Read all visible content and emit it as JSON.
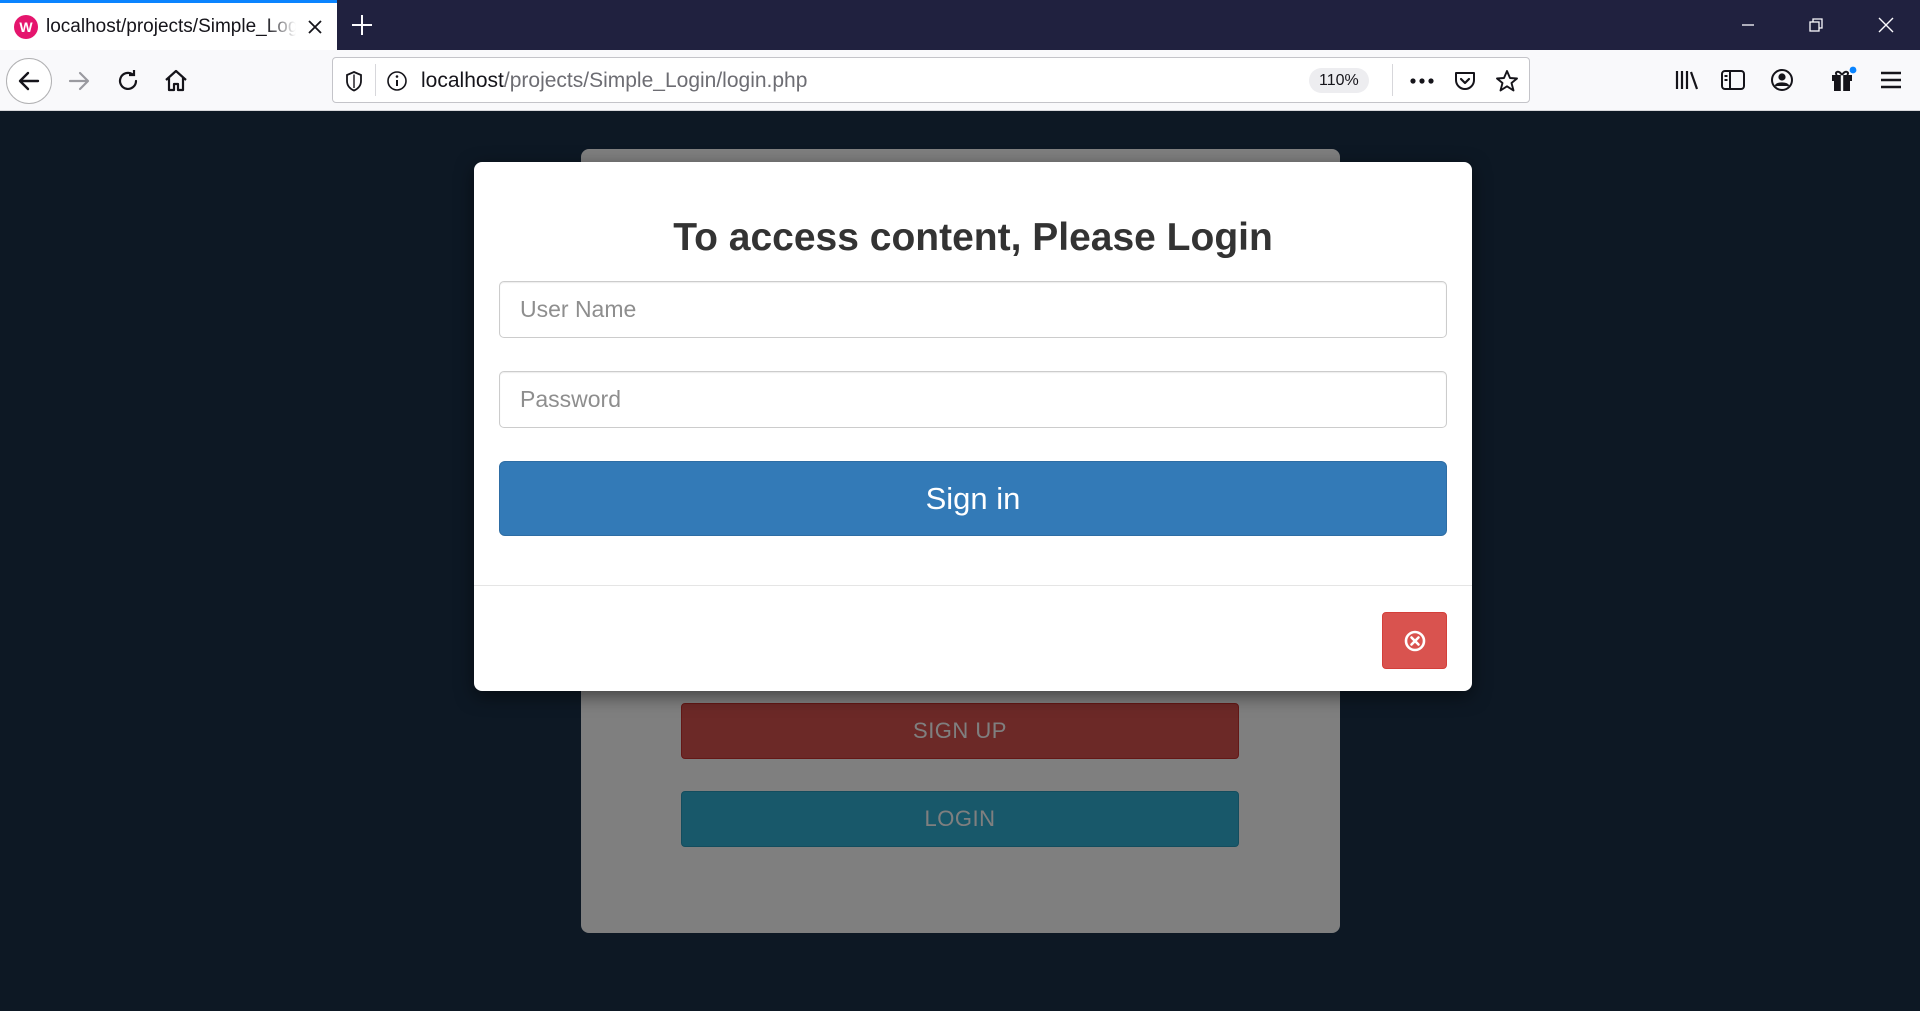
{
  "browser": {
    "tab": {
      "favicon_glyph": "W",
      "title": "localhost/projects/Simple_Login/login.php"
    },
    "url": {
      "host": "localhost",
      "path": "/projects/Simple_Login/login.php"
    },
    "zoom": "110%"
  },
  "page": {
    "signup_label": "SIGN UP",
    "login_label": "LOGIN"
  },
  "modal": {
    "title": "To access content, Please Login",
    "username_placeholder": "User Name",
    "password_placeholder": "Password",
    "signin_label": "Sign in"
  },
  "colors": {
    "page_bg": "#1b3148",
    "primary": "#337ab7",
    "danger": "#d9534f",
    "info": "#31b0d5",
    "tab_accent": "#0a84ff"
  }
}
